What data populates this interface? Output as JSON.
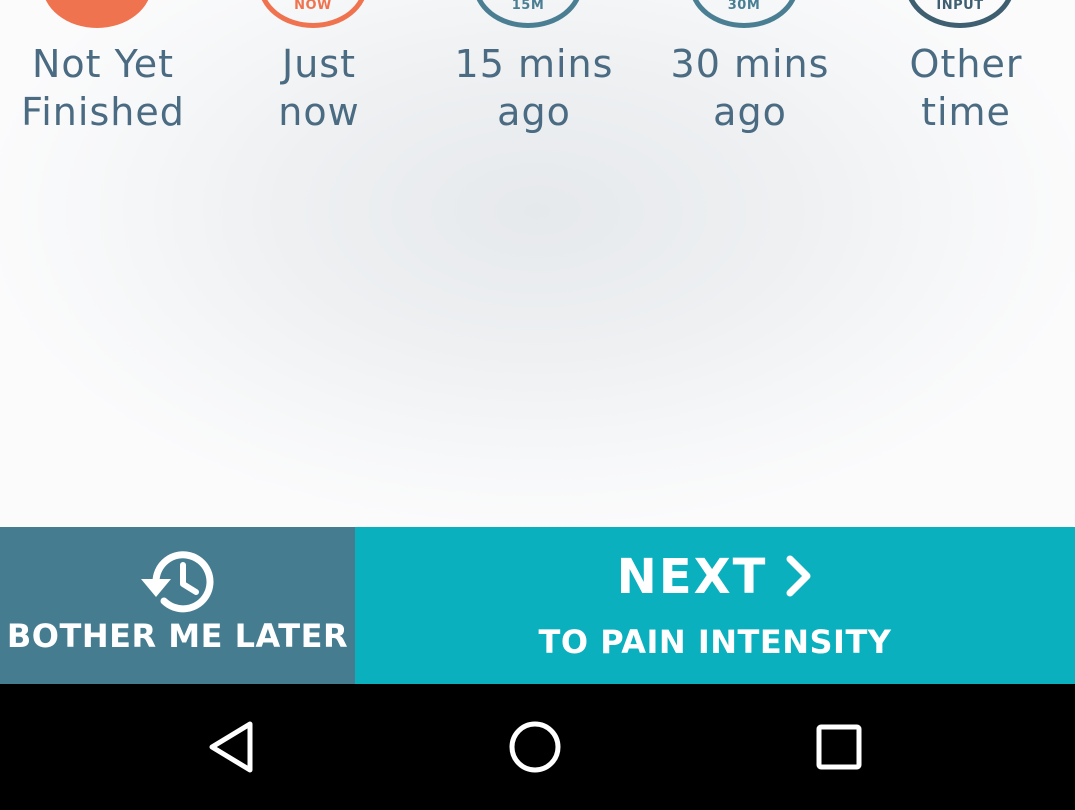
{
  "time_options": [
    {
      "label_line1": "Not Yet",
      "label_line2": "Finished",
      "tag": "",
      "selected": true
    },
    {
      "label_line1": "Just",
      "label_line2": "now",
      "tag": "NOW",
      "selected": false
    },
    {
      "label_line1": "15 mins",
      "label_line2": "ago",
      "tag": "15M",
      "selected": false
    },
    {
      "label_line1": "30 mins",
      "label_line2": "ago",
      "tag": "30M",
      "selected": false
    },
    {
      "label_line1": "Other",
      "label_line2": "time",
      "tag": "INPUT",
      "selected": false
    }
  ],
  "actions": {
    "later_label": "BOTHER ME LATER",
    "next_label": "NEXT",
    "next_sub_label": "TO PAIN INTENSITY"
  },
  "nav": {
    "back": "back-icon",
    "home": "home-icon",
    "recents": "recents-icon"
  },
  "colors": {
    "accent_orange": "#f0734f",
    "label_blue": "#4a6b82",
    "later_bg": "#457c90",
    "next_bg": "#0ab0be"
  }
}
